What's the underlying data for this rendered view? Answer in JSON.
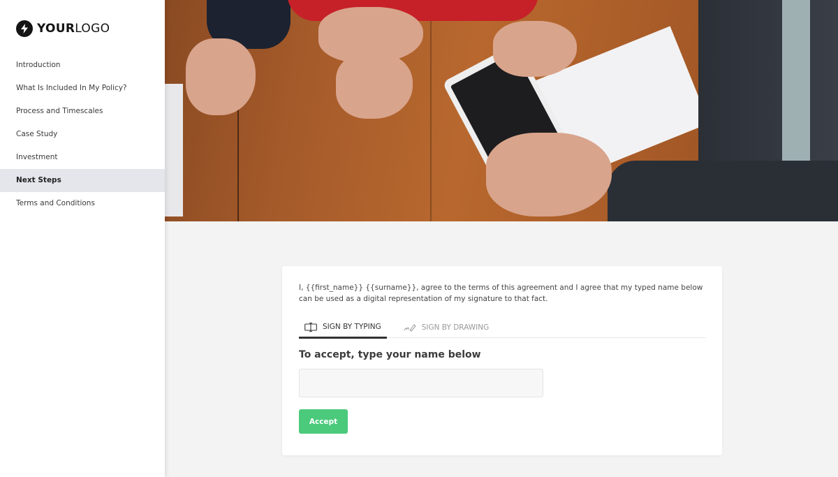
{
  "logo": {
    "bold": "YOUR",
    "regular": "LOGO",
    "icon": "lightning-bolt-icon"
  },
  "sidebar": {
    "items": [
      {
        "label": "Introduction",
        "active": false
      },
      {
        "label": "What Is Included In My Policy?",
        "active": false
      },
      {
        "label": "Process and Timescales",
        "active": false
      },
      {
        "label": "Case Study",
        "active": false
      },
      {
        "label": "Investment",
        "active": false
      },
      {
        "label": "Next Steps",
        "active": true
      },
      {
        "label": "Terms and Conditions",
        "active": false
      }
    ]
  },
  "hero": {
    "description": "Photo of people signing documents on a tablet at a wooden table"
  },
  "signature": {
    "agreement_text": "I, {{first_name}} {{surname}}, agree to the terms of this agreement and I agree that my typed name below can be used as a digital representation of my signature to that fact.",
    "tabs": [
      {
        "label": "SIGN BY TYPING",
        "icon": "text-cursor-icon",
        "active": true
      },
      {
        "label": "SIGN BY DRAWING",
        "icon": "pen-signature-icon",
        "active": false
      }
    ],
    "accept_label": "To accept, type your name below",
    "name_input": {
      "value": "",
      "placeholder": ""
    },
    "accept_button": "Accept"
  },
  "colors": {
    "accent_green": "#4cca7c",
    "active_nav_bg": "#e4e6ec",
    "page_bg": "#f3f3f3"
  }
}
